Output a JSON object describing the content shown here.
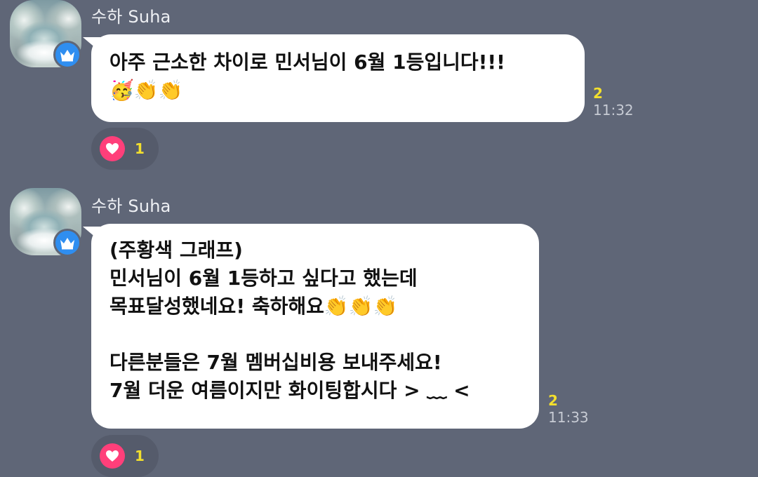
{
  "messages": [
    {
      "sender": "수하 Suha",
      "text": "아주 근소한 차이로 민서님이 6월 1등입니다!!!\n🥳👏👏",
      "unread": "2",
      "time": "11:32",
      "reaction": {
        "icon": "heart-icon",
        "count": "1"
      }
    },
    {
      "sender": "수하 Suha",
      "text": "(주황색 그래프)\n민서님이 6월 1등하고 싶다고 했는데\n목표달성했네요! 축하해요👏👏👏\n\n다른분들은 7월 멤버십비용 보내주세요!\n7월 더운 여름이지만 화이팅합시다 > ﹏ <",
      "unread": "2",
      "time": "11:33",
      "reaction": {
        "icon": "heart-icon",
        "count": "1"
      }
    }
  ],
  "colors": {
    "background": "#5f6677",
    "bubble": "#ffffff",
    "unread": "#f3df2d",
    "heart": "#ff3f7a",
    "badge": "#2f8ef0"
  }
}
